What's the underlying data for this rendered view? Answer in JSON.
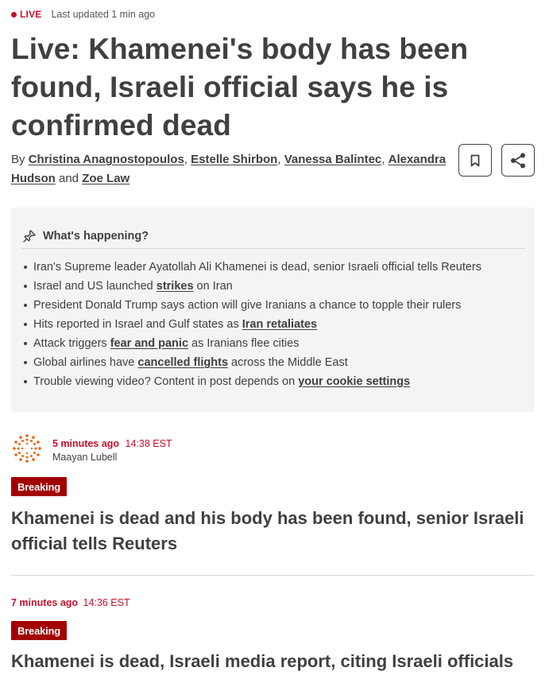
{
  "status": {
    "live_label": "LIVE",
    "last_updated": "Last updated 1 min ago"
  },
  "article": {
    "headline": "Live: Khamenei's body has been found, Israeli official says he is confirmed dead",
    "byline": {
      "prefix": "By",
      "authors": [
        "Christina Anagnostopoulos",
        "Estelle Shirbon",
        "Vanessa Balintec",
        "Alexandra Hudson",
        "Zoe Law"
      ],
      "separator": ",",
      "conjunction": "and"
    },
    "actions": {
      "bookmark_icon": "bookmark-icon",
      "share_icon": "share-icon"
    }
  },
  "happening": {
    "title": "What's happening?",
    "icon": "pin-icon",
    "items": [
      {
        "before": "Iran's Supreme leader Ayatollah Ali Khamenei is dead, senior Israeli official tells Reuters",
        "link": "",
        "after": ""
      },
      {
        "before": "Israel and US launched ",
        "link": "strikes",
        "after": " on Iran"
      },
      {
        "before": "President Donald Trump says action will give Iranians a chance to topple their rulers",
        "link": "",
        "after": ""
      },
      {
        "before": "Hits reported in Israel and Gulf states as ",
        "link": "Iran retaliates",
        "after": ""
      },
      {
        "before": "Attack triggers ",
        "link": "fear and panic",
        "after": " as Iranians flee cities"
      },
      {
        "before": "Global airlines have ",
        "link": "cancelled flights",
        "after": " across the Middle East"
      },
      {
        "before": "Trouble viewing video? Content in post depends on ",
        "link": "your cookie settings",
        "after": ""
      }
    ]
  },
  "posts": [
    {
      "ago": "5 minutes ago",
      "time": "14:38 EST",
      "author": "Maayan Lubell",
      "badge": "Breaking",
      "title": "Khamenei is dead and his body has been found, senior Israeli official tells Reuters"
    },
    {
      "ago": "7 minutes ago",
      "time": "14:36 EST",
      "badge": "Breaking",
      "title": "Khamenei is dead, Israeli media report, citing Israeli officials"
    }
  ],
  "colors": {
    "accent_red": "#c8102e",
    "badge_red": "#a30000",
    "text": "#404040",
    "panel_bg": "#f4f4f4"
  }
}
